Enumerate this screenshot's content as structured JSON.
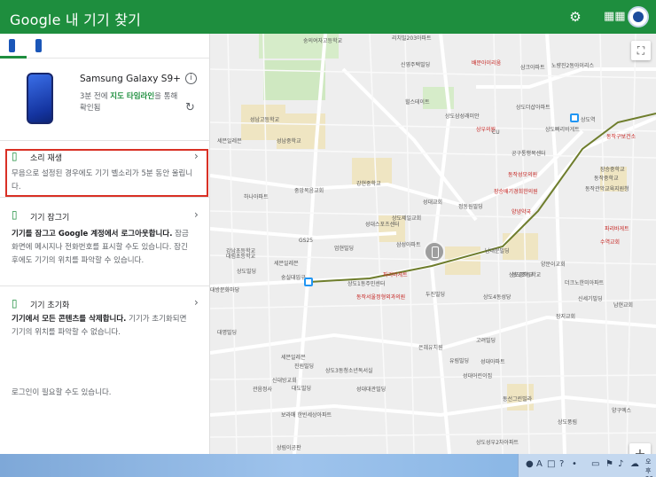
{
  "header": {
    "title": "Google 내 기기 찾기",
    "settings_icon": "gear-icon",
    "apps_icon": "grid-icon"
  },
  "device": {
    "name": "Samsung Galaxy S9+",
    "last_seen_prefix": "3분 전에",
    "last_seen_link": "지도 타임라인",
    "last_seen_suffix": "을 통해 확인됨",
    "accent_color": "#1e8e3e"
  },
  "actions": {
    "play_sound": {
      "title": "소리 재생",
      "description": "무음으로 설정된 경우에도 기기 벨소리가 5분 동안 울립니다."
    },
    "secure_device": {
      "title": "기기 잠그기",
      "description_bold": "기기를 잠그고 Google 계정에서 로그아웃합니다.",
      "description": "잠금 화면에 메시지나 전화번호를 표시할 수도 있습니다. 잠긴 후에도 기기의 위치를 파악할 수 있습니다."
    },
    "erase_device": {
      "title": "기기 초기화",
      "description_bold": "기기에서 모든 콘텐츠를 삭제합니다.",
      "description": "기기가 초기화되면 기기의 위치를 파악할 수 없습니다."
    },
    "login_note": "로그인이 필요할 수도 있습니다."
  },
  "map": {
    "labels": [
      {
        "t": "숭의여자고등학교"
      },
      {
        "t": "리치빌203아파트"
      },
      {
        "t": "신영주택빌딩"
      },
      {
        "t": "배문아이리움"
      },
      {
        "t": "삼크아파트"
      },
      {
        "t": "노량진2동아이리스"
      },
      {
        "t": "상도더샵아파트"
      },
      {
        "t": "힐스테이트"
      },
      {
        "t": "성남고등학교"
      },
      {
        "t": "성남중학교"
      },
      {
        "t": "세븐일레븐"
      },
      {
        "t": "상도삼성래미안"
      },
      {
        "t": "상우의원"
      },
      {
        "t": "상도빠리바게트"
      },
      {
        "t": "상도역"
      },
      {
        "t": "동작구보건소"
      },
      {
        "t": "공구통행복센터"
      },
      {
        "t": "장승중학교"
      },
      {
        "t": "동작성모의원"
      },
      {
        "t": "중앙복음교회"
      },
      {
        "t": "강현중학교"
      },
      {
        "t": "하나아파트"
      },
      {
        "t": "강남초등학교"
      },
      {
        "t": "성대교회"
      },
      {
        "t": "정동원빌딩"
      },
      {
        "t": "장승배기경희한의원"
      },
      {
        "t": "상도초등학교"
      },
      {
        "t": "대림초등학교"
      },
      {
        "t": "상도빌딩"
      },
      {
        "t": "양녕약국"
      },
      {
        "t": "숭실대입구"
      },
      {
        "t": "세븐일레븐"
      },
      {
        "t": "대방문화마당"
      },
      {
        "t": "파리바게트"
      },
      {
        "t": "상도1동주민센터"
      },
      {
        "t": "동작서울정형외과의원"
      },
      {
        "t": "두진빌딩"
      },
      {
        "t": "GS25"
      },
      {
        "t": "CU"
      },
      {
        "t": "상도중학교"
      },
      {
        "t": "양문이교회"
      },
      {
        "t": "상도4동성당"
      },
      {
        "t": "더크노한미아파트"
      },
      {
        "t": "신세기빌딩"
      },
      {
        "t": "남현교회"
      },
      {
        "t": "장지교회"
      },
      {
        "t": "대명빌딩"
      },
      {
        "t": "고려빌딩"
      },
      {
        "t": "은혜유치원"
      },
      {
        "t": "성대아파트"
      },
      {
        "t": "유림빌딩"
      },
      {
        "t": "상도3동청소년독서실"
      },
      {
        "t": "세븐일레븐"
      },
      {
        "t": "신대방교회"
      },
      {
        "t": "진원빌딩"
      },
      {
        "t": "관음정사"
      },
      {
        "t": "대도빌딩"
      },
      {
        "t": "성대대관빌딩"
      },
      {
        "t": "성대어린이집"
      },
      {
        "t": "동선그린빌라"
      },
      {
        "t": "보라매 한빈세상아파트"
      },
      {
        "t": "상도성우2차아파트"
      },
      {
        "t": "상림이공판"
      },
      {
        "t": "파리바게트"
      },
      {
        "t": "수역교회"
      },
      {
        "t": "동작중학교"
      },
      {
        "t": "동작관악교육지원청"
      },
      {
        "t": "양구엑스"
      },
      {
        "t": "상도풍림"
      },
      {
        "t": "삼성아파트"
      },
      {
        "t": "엄현빌딩"
      },
      {
        "t": "성대스포츠센터"
      },
      {
        "t": "상도제일교회"
      },
      {
        "t": "남대문빌딩"
      }
    ]
  },
  "taskbar": {
    "time": "오후",
    "date": "20"
  }
}
